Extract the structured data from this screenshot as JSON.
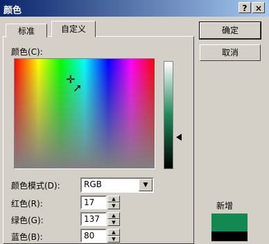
{
  "window": {
    "title": "颜色",
    "help_label": "?",
    "close_label": "×"
  },
  "tabs": [
    {
      "label": "标准"
    },
    {
      "label": "自定义"
    }
  ],
  "custom": {
    "colors_label": "颜色(C):",
    "model_label": "颜色模式(D):",
    "model_value": "RGB",
    "red_label": "红色(R):",
    "red_value": "17",
    "green_label": "绿色(G):",
    "green_value": "137",
    "blue_label": "蓝色(B):",
    "blue_value": "80"
  },
  "buttons": {
    "ok": "确定",
    "cancel": "取消"
  },
  "preview": {
    "new_label": "新增",
    "new_color": "#118950",
    "current_color": "#000000"
  },
  "icons": [
    "help-icon",
    "close-icon",
    "dropdown-arrow-icon",
    "spin-up-icon",
    "spin-down-icon",
    "crosshair-icon",
    "pointer-icon",
    "slider-arrow-icon"
  ]
}
